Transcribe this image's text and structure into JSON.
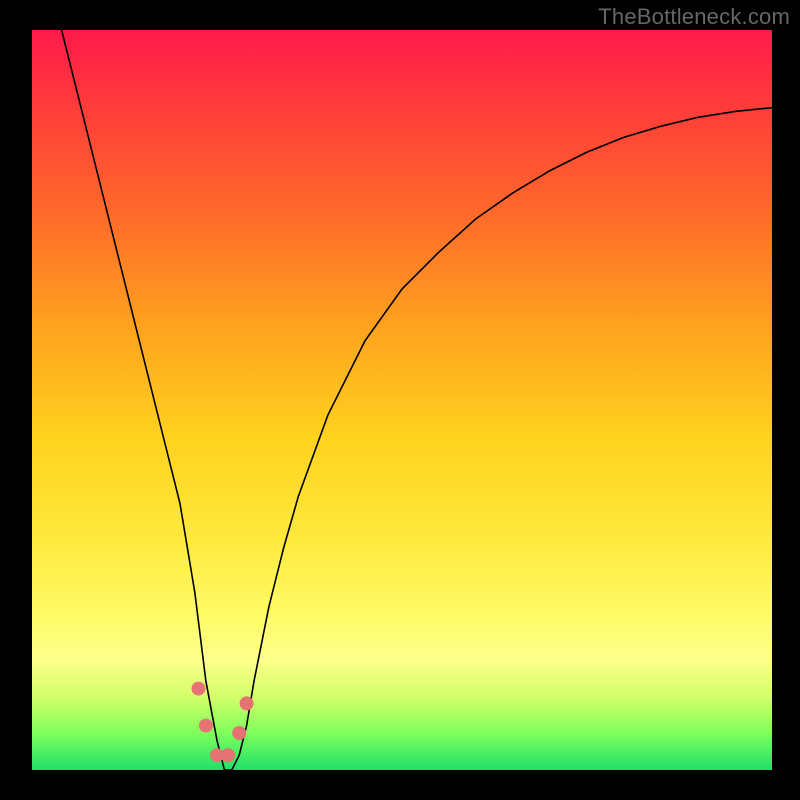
{
  "watermark": "TheBottleneck.com",
  "colors": {
    "frame": "#000000",
    "gradient_top": "#ff1a4b",
    "gradient_mid_orange": "#ffa21e",
    "gradient_mid_yellow": "#ffe83a",
    "gradient_bottom": "#1fe06a",
    "curve": "#000000",
    "marker": "#e57373"
  },
  "chart_data": {
    "type": "line",
    "title": "",
    "xlabel": "",
    "ylabel": "",
    "xlim": [
      0,
      100
    ],
    "ylim": [
      0,
      100
    ],
    "grid": false,
    "legend": false,
    "series": [
      {
        "name": "bottleneck-curve",
        "x": [
          4,
          6,
          8,
          10,
          12,
          14,
          16,
          18,
          20,
          22,
          23.5,
          25,
          26,
          27,
          28,
          29,
          30,
          32,
          34,
          36,
          40,
          45,
          50,
          55,
          60,
          65,
          70,
          75,
          80,
          85,
          90,
          95,
          100
        ],
        "values": [
          100,
          92,
          84,
          76,
          68,
          60,
          52,
          44,
          36,
          24,
          12,
          4,
          0,
          0,
          2,
          6,
          12,
          22,
          30,
          37,
          48,
          58,
          65,
          70,
          74.5,
          78,
          81,
          83.5,
          85.5,
          87,
          88.2,
          89,
          89.5
        ]
      }
    ],
    "markers": [
      {
        "x": 22.5,
        "y": 11
      },
      {
        "x": 23.5,
        "y": 6
      },
      {
        "x": 25.0,
        "y": 2
      },
      {
        "x": 26.5,
        "y": 2
      },
      {
        "x": 28.0,
        "y": 5
      },
      {
        "x": 29.0,
        "y": 9
      }
    ]
  }
}
